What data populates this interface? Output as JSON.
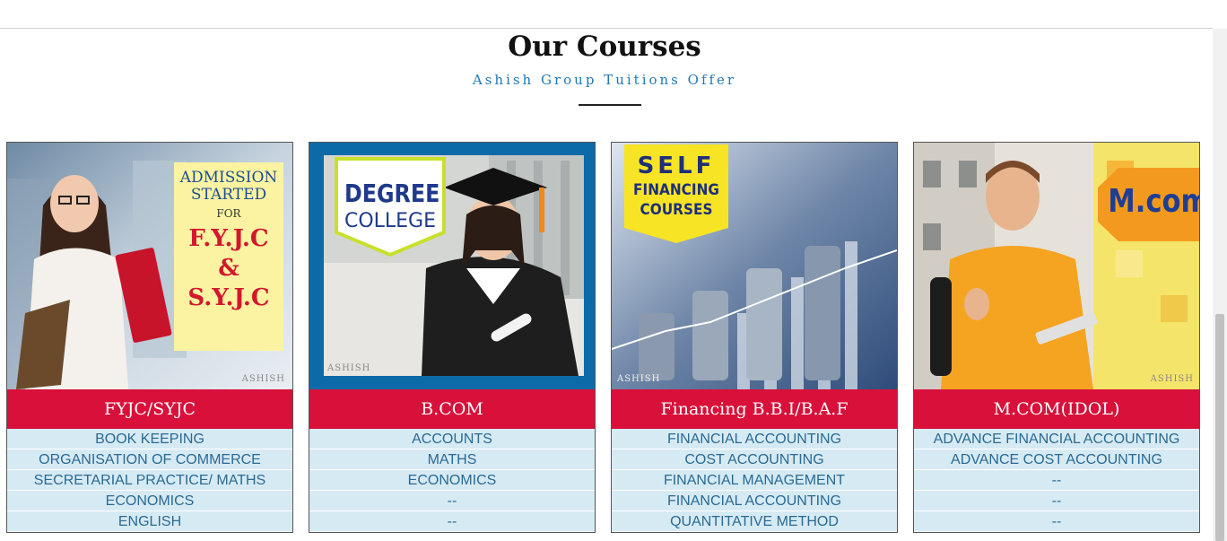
{
  "header": {
    "title": "Our Courses",
    "subtitle": "Ashish Group Tuitions Offer"
  },
  "cards": [
    {
      "heading": "FYJC/SYJC",
      "image": {
        "lines": [
          "ADMISSION",
          "STARTED",
          "FOR",
          "F.Y.J.C",
          "&",
          "S.Y.J.C"
        ],
        "watermark": "ASHISH"
      },
      "rows": [
        "BOOK KEEPING",
        "ORGANISATION OF COMMERCE",
        "SECRETARIAL PRACTICE/ MATHS",
        "ECONOMICS",
        "ENGLISH"
      ]
    },
    {
      "heading": "B.COM",
      "image": {
        "lines": [
          "DEGREE",
          "COLLEGE"
        ],
        "watermark": "ASHISH"
      },
      "rows": [
        "ACCOUNTS",
        "MATHS",
        "ECONOMICS",
        "--",
        "--"
      ]
    },
    {
      "heading": "Financing B.B.I/B.A.F",
      "image": {
        "lines": [
          "SELF",
          "FINANCING",
          "COURSES"
        ],
        "watermark": "ASHISH"
      },
      "rows": [
        "FINANCIAL ACCOUNTING",
        "COST ACCOUNTING",
        "FINANCIAL MANAGEMENT",
        "FINANCIAL ACCOUNTING",
        "QUANTITATIVE METHOD"
      ]
    },
    {
      "heading": "M.COM(IDOL)",
      "image": {
        "lines": [
          "M.com"
        ],
        "watermark": "ASHISH"
      },
      "rows": [
        "ADVANCE FINANCIAL ACCOUNTING",
        "ADVANCE COST ACCOUNTING",
        "--",
        "--",
        "--"
      ]
    }
  ]
}
